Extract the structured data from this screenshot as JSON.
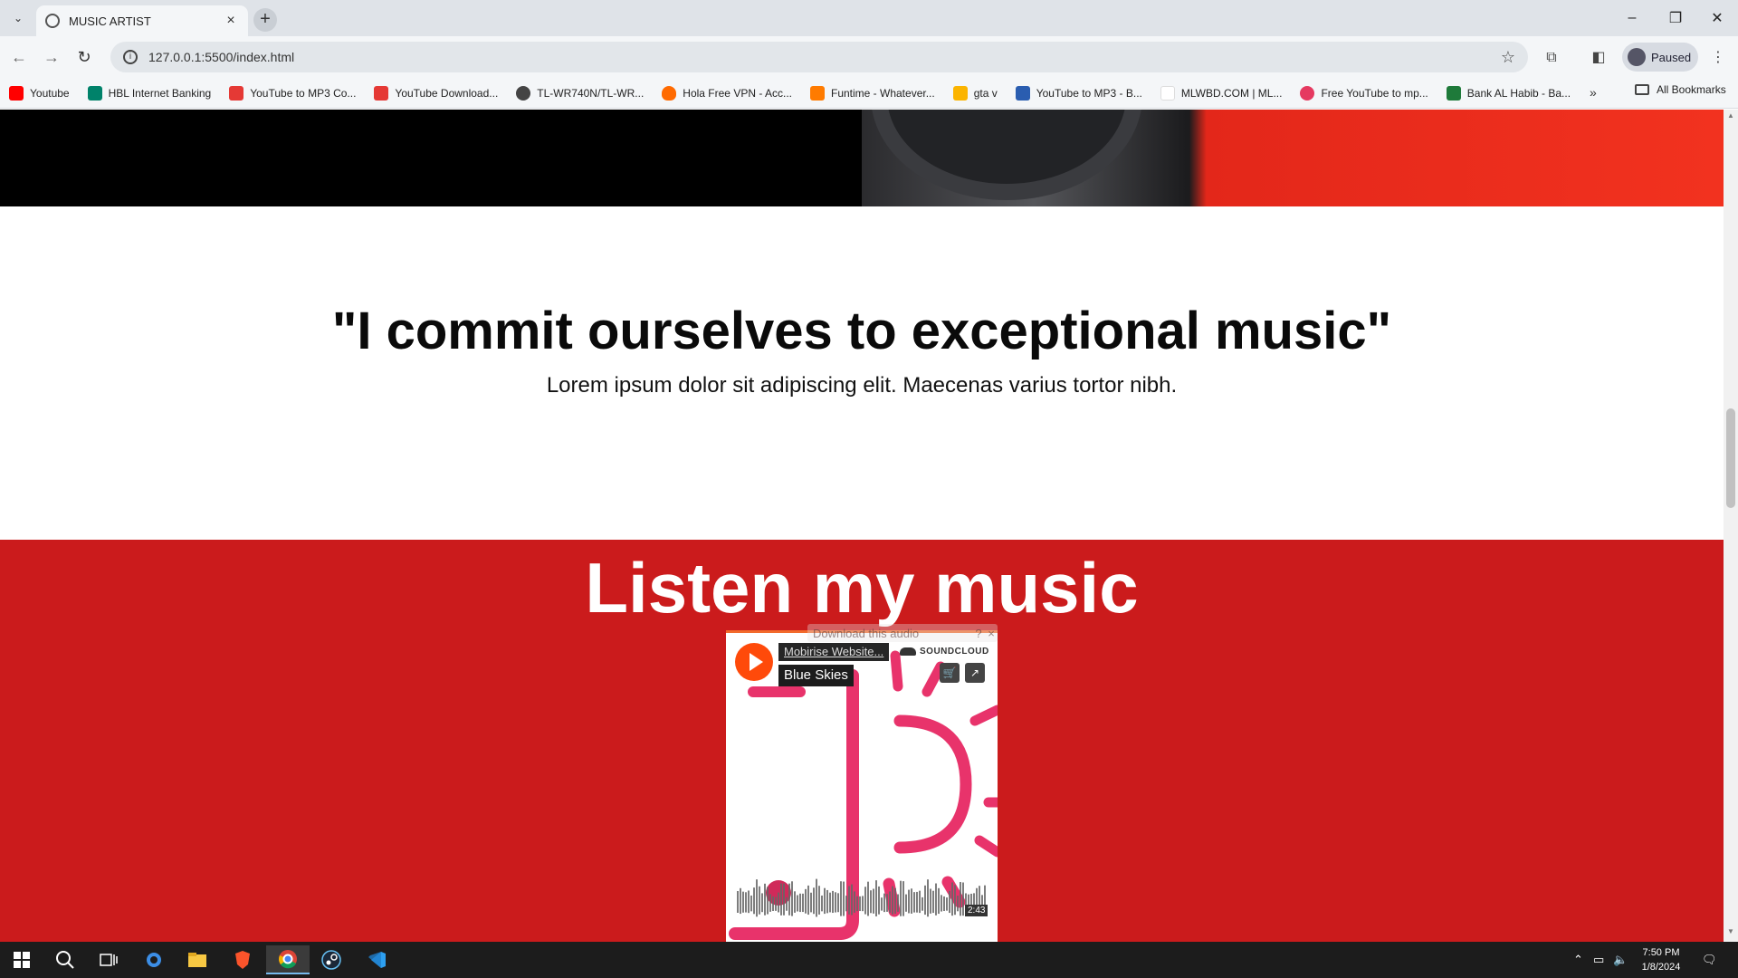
{
  "browser": {
    "tab_title": "MUSIC ARTIST",
    "url": "127.0.0.1:5500/index.html",
    "profile_label": "Paused",
    "bookmarks": [
      {
        "label": "Youtube",
        "color": "#ff0000"
      },
      {
        "label": "HBL Internet Banking",
        "color": "#00826a"
      },
      {
        "label": "YouTube to MP3 Co...",
        "color": "#e53935"
      },
      {
        "label": "YouTube Download...",
        "color": "#e53935"
      },
      {
        "label": "TL-WR740N/TL-WR...",
        "color": "#444444"
      },
      {
        "label": "Hola Free VPN - Acc...",
        "color": "#ff6a00"
      },
      {
        "label": "Funtime - Whatever...",
        "color": "#ff7b00"
      },
      {
        "label": "gta v",
        "color": "#fbb400"
      },
      {
        "label": "YouTube to MP3 - B...",
        "color": "#2a5db0"
      },
      {
        "label": "MLWBD.COM | ML...",
        "color": "#ffffff"
      },
      {
        "label": "Free YouTube to mp...",
        "color": "#e53960"
      },
      {
        "label": "Bank AL Habib - Ba...",
        "color": "#1e7a3a"
      }
    ],
    "all_bookmarks_label": "All Bookmarks"
  },
  "page": {
    "quote": "\"I commit ourselves to exceptional music\"",
    "quote_sub": "Lorem ipsum dolor sit adipiscing elit. Maecenas varius tortor nibh.",
    "music_title": "Listen my music",
    "accent_color": "#cb1b1c"
  },
  "player": {
    "download_label": "Download this audio",
    "download_help": "?",
    "download_close": "×",
    "artist": "Mobirise Website...",
    "track": "Blue Skies",
    "brand": "SOUNDCLOUD",
    "duration": "2:43"
  },
  "taskbar": {
    "time": "7:50 PM",
    "date": "1/8/2024"
  }
}
